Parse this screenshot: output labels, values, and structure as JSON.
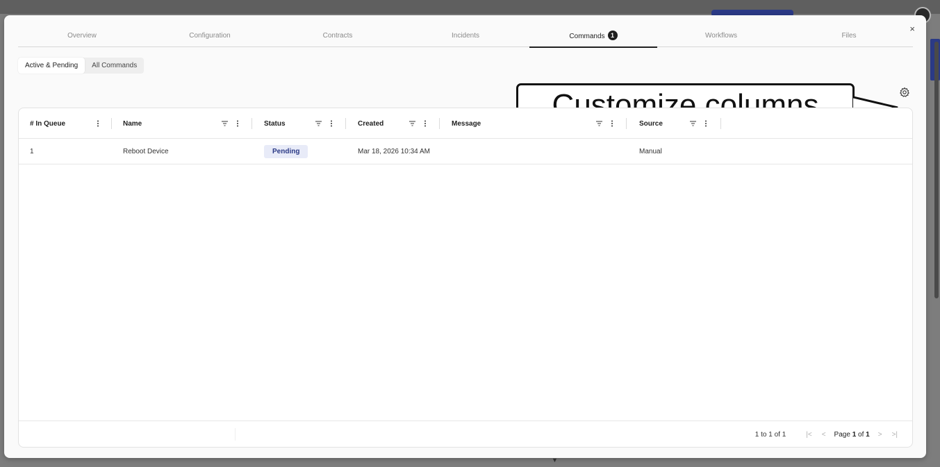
{
  "modal": {
    "close_label": "×"
  },
  "tabs": [
    {
      "label": "Overview"
    },
    {
      "label": "Configuration"
    },
    {
      "label": "Contracts"
    },
    {
      "label": "Incidents"
    },
    {
      "label": "Commands",
      "badge": "1",
      "active": true
    },
    {
      "label": "Workflows"
    },
    {
      "label": "Files"
    }
  ],
  "filter_toggle": {
    "active_label": "Active & Pending",
    "all_label": "All Commands"
  },
  "table": {
    "columns": [
      "# In Queue",
      "Name",
      "Status",
      "Created",
      "Message",
      "Source"
    ],
    "rows": [
      {
        "queue": "1",
        "name": "Reboot Device",
        "status": "Pending",
        "created": "Mar 18, 2026 10:34 AM",
        "message": "",
        "source": "Manual"
      }
    ]
  },
  "pagination": {
    "count_text": "1 to 1 of 1",
    "page_prefix": "Page ",
    "page_current": "1",
    "page_of": " of ",
    "page_total": "1"
  },
  "annotation": {
    "callout_text": "Customize columns"
  },
  "icons": {
    "settings": "gear-icon",
    "filter": "filter-icon",
    "column_menu": "vertical-dots-icon",
    "first_page": "first-page-icon",
    "prev_page": "chevron-left-icon",
    "next_page": "chevron-right-icon",
    "last_page": "last-page-icon"
  },
  "colors": {
    "accent": "#2b3a86",
    "badge_bg": "#e8ebf8"
  }
}
